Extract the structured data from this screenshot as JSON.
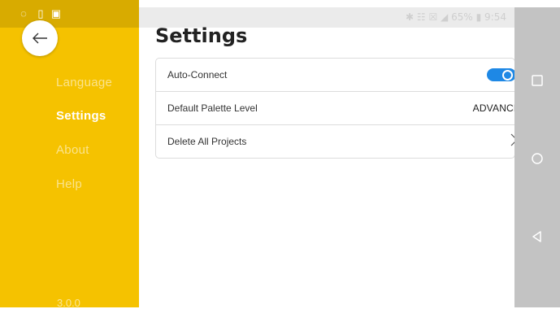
{
  "sidebar": {
    "items": [
      {
        "label": "Language",
        "active": false
      },
      {
        "label": "Settings",
        "active": true
      },
      {
        "label": "About",
        "active": false
      },
      {
        "label": "Help",
        "active": false
      }
    ],
    "version": "3.0.0",
    "accent_color": "#f5c200"
  },
  "status": {
    "battery": "65%",
    "time": "9:54"
  },
  "main": {
    "title": "Settings",
    "rows": [
      {
        "label": "Auto-Connect",
        "toggle_on": true
      },
      {
        "label": "Default Palette Level",
        "value": "ADVANCED"
      },
      {
        "label": "Delete All Projects"
      }
    ],
    "toggle_color": "#1e88e5"
  }
}
